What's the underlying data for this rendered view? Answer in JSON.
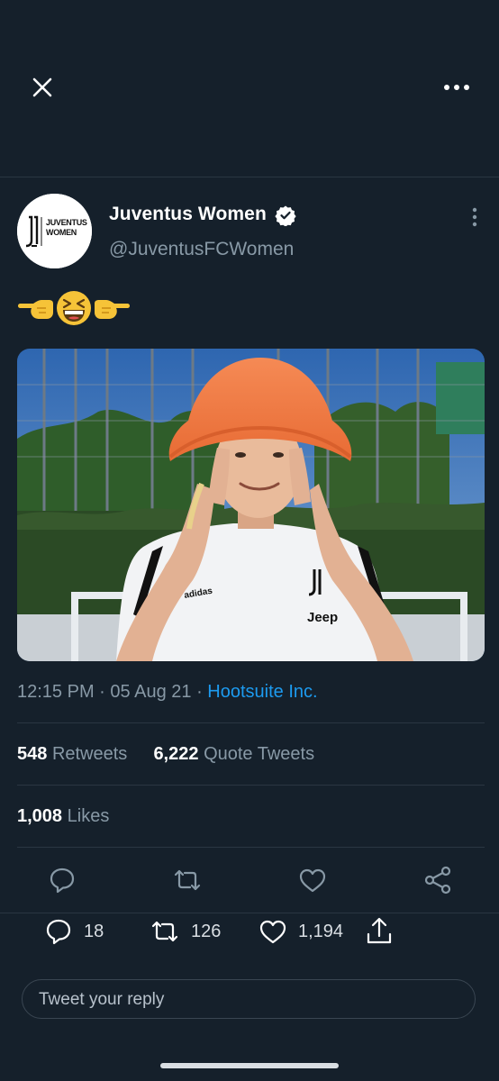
{
  "header": {
    "close_icon": "close-icon",
    "more_icon": "more-horizontal-icon"
  },
  "tweet": {
    "author_name": "Juventus Women",
    "handle": "@JuventusFCWomen",
    "avatar_text_line1": "JUVENTUS",
    "avatar_text_line2": "WOMEN",
    "verified": true,
    "text_emojis": [
      "backhand-index-pointing-left",
      "grinning-squinting-face",
      "backhand-index-pointing-right"
    ],
    "media": {
      "shirt_brand_left": "adidas",
      "shirt_brand_right": "Jeep"
    },
    "time": "12:15 PM",
    "date": "05 Aug 21",
    "separator": "·",
    "source": "Hootsuite Inc."
  },
  "stats": {
    "retweets_count": "548",
    "retweets_label": "Retweets",
    "quotes_count": "6,222",
    "quotes_label": "Quote Tweets",
    "likes_count": "1,008",
    "likes_label": "Likes"
  },
  "bottom_bar": {
    "replies": "18",
    "retweets": "126",
    "likes": "1,194"
  },
  "reply": {
    "placeholder": "Tweet your reply"
  },
  "colors": {
    "background": "#15202b",
    "secondary_text": "#8899a6",
    "link": "#1d9bf0",
    "divider": "#2a3642"
  }
}
